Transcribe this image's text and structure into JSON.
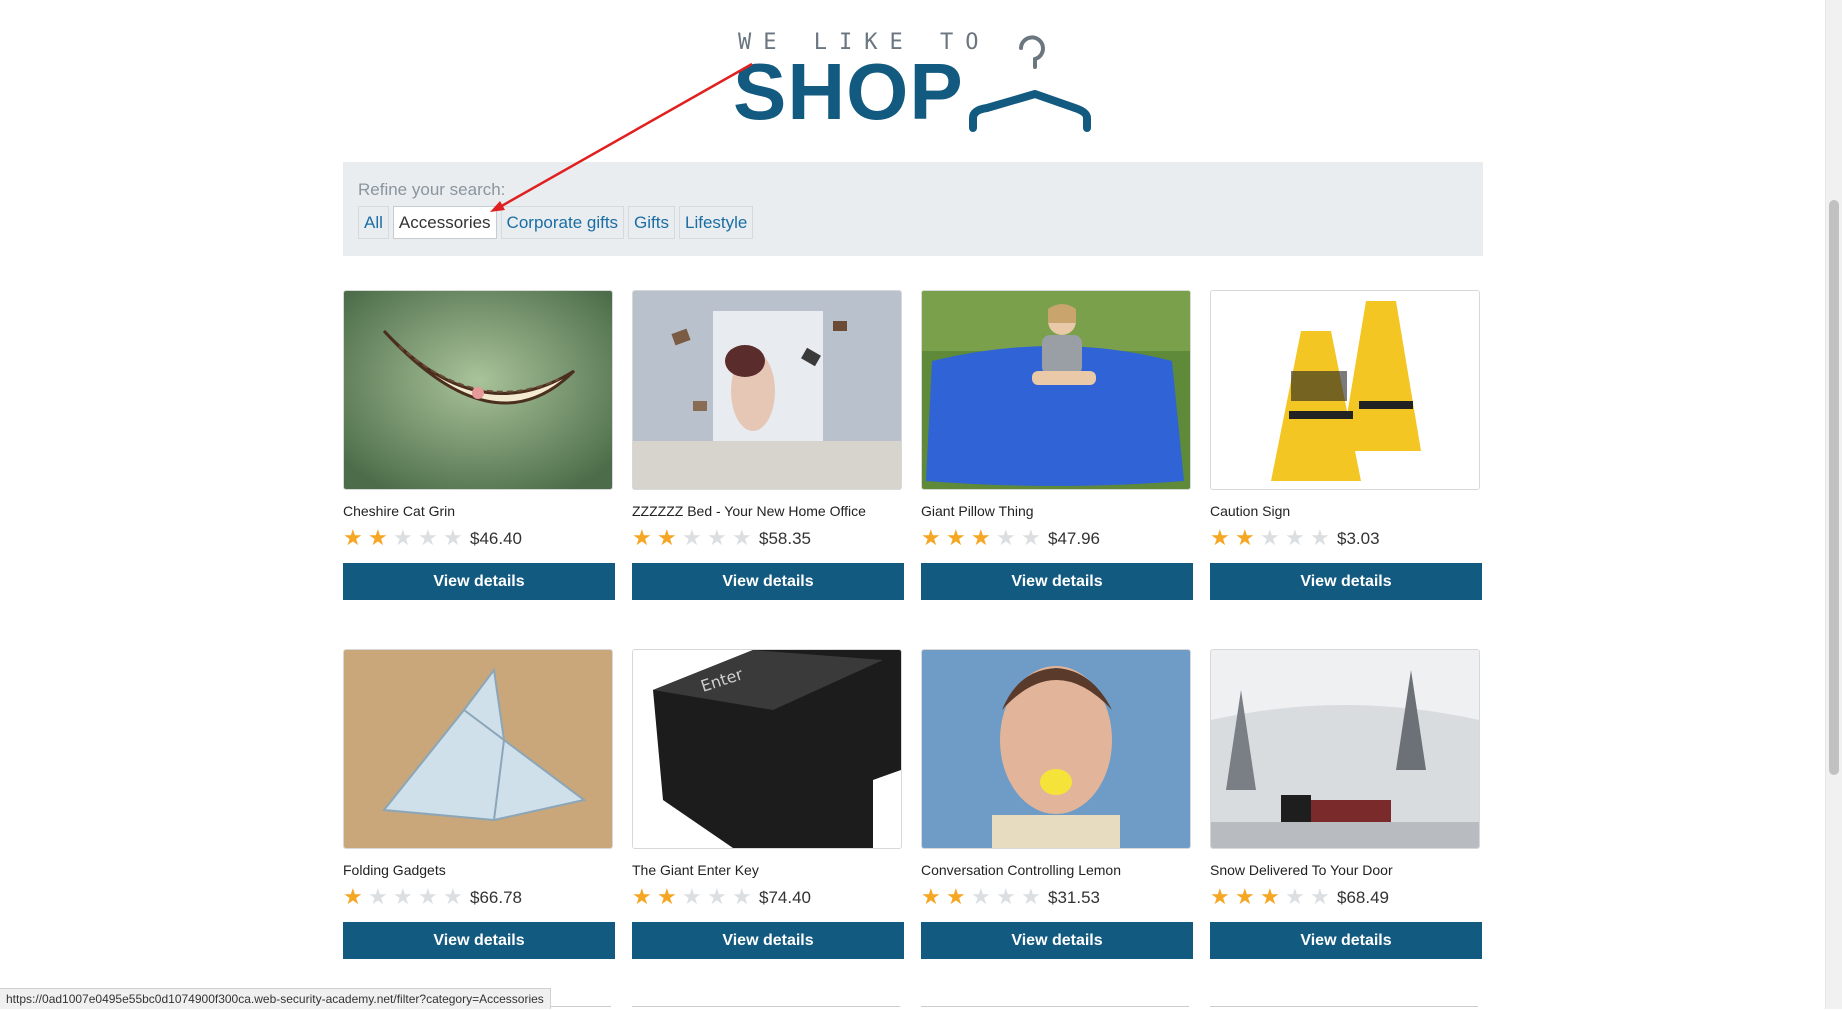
{
  "logo": {
    "tagline": "WE LIKE TO",
    "word": "SHOP"
  },
  "filter": {
    "refine_label": "Refine your search:",
    "categories": [
      "All",
      "Accessories",
      "Corporate gifts",
      "Gifts",
      "Lifestyle"
    ],
    "active_category": "Accessories"
  },
  "products": [
    {
      "title": "Cheshire Cat Grin",
      "rating": 2,
      "price": "$46.40",
      "button": "View details",
      "image": "cheshire-cat-grin-image"
    },
    {
      "title": "ZZZZZZ Bed - Your New Home Office",
      "rating": 2,
      "price": "$58.35",
      "button": "View details",
      "image": "floating-books-bed-image"
    },
    {
      "title": "Giant Pillow Thing",
      "rating": 3,
      "price": "$47.96",
      "button": "View details",
      "image": "blue-giant-pillow-image"
    },
    {
      "title": "Caution Sign",
      "rating": 2,
      "price": "$3.03",
      "button": "View details",
      "image": "yellow-caution-sign-image"
    },
    {
      "title": "Folding Gadgets",
      "rating": 1,
      "price": "$66.78",
      "button": "View details",
      "image": "origami-bird-image"
    },
    {
      "title": "The Giant Enter Key",
      "rating": 2,
      "price": "$74.40",
      "button": "View details",
      "image": "giant-enter-key-image"
    },
    {
      "title": "Conversation Controlling Lemon",
      "rating": 2,
      "price": "$31.53",
      "button": "View details",
      "image": "lemon-in-mouth-image"
    },
    {
      "title": "Snow Delivered To Your Door",
      "rating": 3,
      "price": "$68.49",
      "button": "View details",
      "image": "snow-train-image"
    }
  ],
  "status_url": "https://0ad1007e0495e55bc0d1074900f300ca.web-security-academy.net/filter?category=Accessories",
  "enter_key_label": "Enter",
  "colors": {
    "brand": "#135a80",
    "star": "#f5a623",
    "annotation": "#e02020"
  }
}
